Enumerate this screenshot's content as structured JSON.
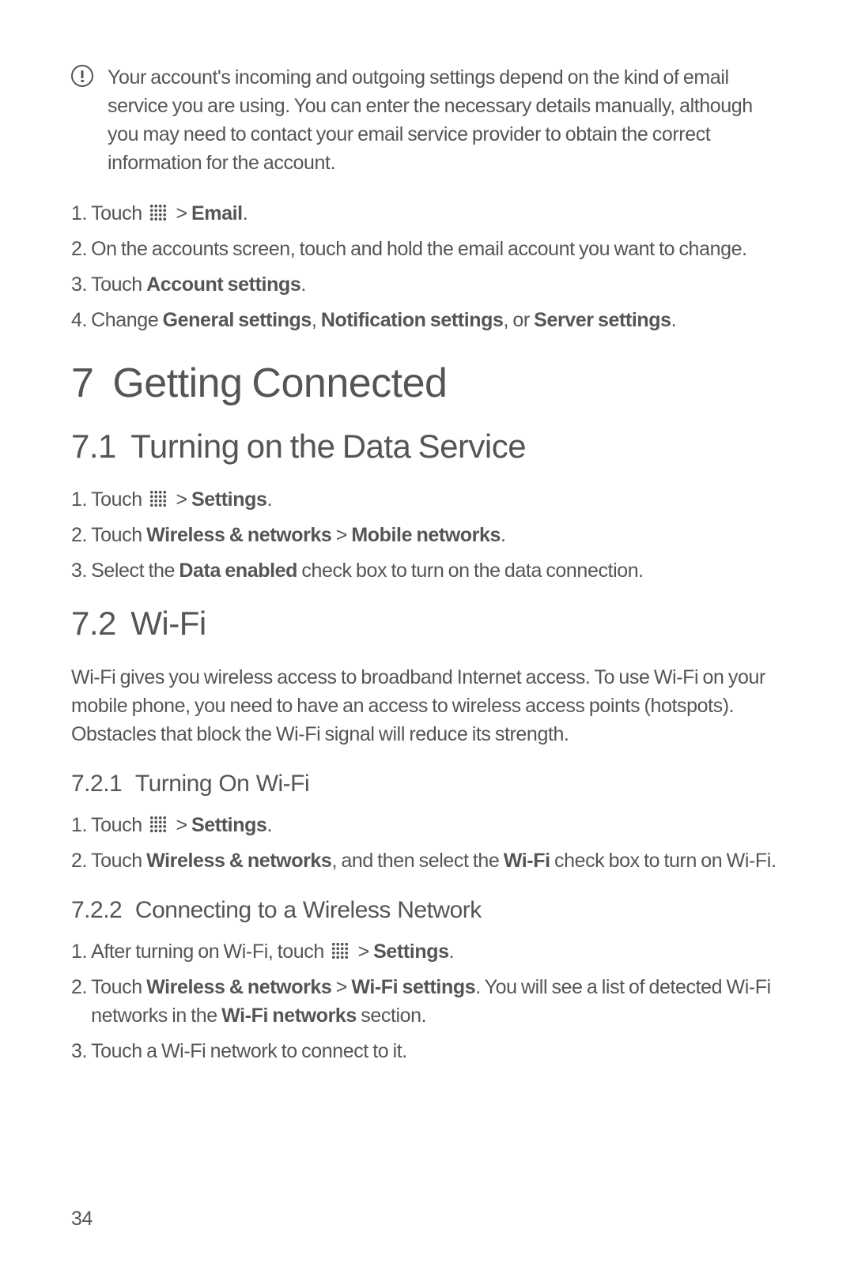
{
  "note": {
    "text": "Your account's incoming and outgoing settings depend on the kind of email service you are using. You can enter the necessary details manually, although you may need to contact your email service provider to obtain the correct information for the account."
  },
  "listA": {
    "i1": {
      "n": "1.",
      "pre": "Touch ",
      "post": " > ",
      "bold": "Email",
      "tail": "."
    },
    "i2": {
      "n": "2.",
      "text": "On the accounts screen, touch and hold the email account you want to change."
    },
    "i3": {
      "n": "3.",
      "pre": "Touch ",
      "bold": "Account settings",
      "tail": "."
    },
    "i4": {
      "n": "4.",
      "pre": "Change ",
      "b1": "General settings",
      "sep1": ", ",
      "b2": "Notification settings",
      "sep2": ", or ",
      "b3": "Server settings",
      "tail": "."
    }
  },
  "h1": {
    "num": "7",
    "title": "Getting Connected"
  },
  "h2a": {
    "num": "7.1",
    "title": "Turning on the Data Service"
  },
  "listB": {
    "i1": {
      "n": "1.",
      "pre": "Touch ",
      "post": " > ",
      "bold": "Settings",
      "tail": "."
    },
    "i2": {
      "n": "2.",
      "pre": "Touch ",
      "b1": "Wireless & networks",
      "sep": " > ",
      "b2": "Mobile networks",
      "tail": "."
    },
    "i3": {
      "n": "3.",
      "pre": "Select the ",
      "bold": "Data enabled",
      "tail": " check box to turn on the data connection."
    }
  },
  "h2b": {
    "num": "7.2",
    "title": "Wi-Fi"
  },
  "wifiPara": "Wi-Fi gives you wireless access to broadband Internet access. To use Wi-Fi on your mobile phone, you need to have an access to wireless access points (hotspots). Obstacles that block the Wi-Fi signal will reduce its strength.",
  "h3a": {
    "num": "7.2.1",
    "title": "Turning On Wi-Fi"
  },
  "listC": {
    "i1": {
      "n": "1.",
      "pre": "Touch ",
      "post": " > ",
      "bold": "Settings",
      "tail": "."
    },
    "i2": {
      "n": "2.",
      "pre": "Touch ",
      "b1": "Wireless & networks",
      "mid": ", and then select the ",
      "b2": "Wi-Fi",
      "tail": " check box to turn on Wi-Fi."
    }
  },
  "h3b": {
    "num": "7.2.2",
    "title": "Connecting to a Wireless Network"
  },
  "listD": {
    "i1": {
      "n": "1.",
      "pre": "After turning on Wi-Fi, touch ",
      "post": " > ",
      "bold": "Settings",
      "tail": "."
    },
    "i2": {
      "n": "2.",
      "pre": "Touch ",
      "b1": "Wireless & networks",
      "sep": " > ",
      "b2": "Wi-Fi settings",
      "mid": ". You will see a list of detected Wi-Fi networks in the ",
      "b3": "Wi-Fi networks",
      "tail": " section."
    },
    "i3": {
      "n": "3.",
      "text": "Touch a Wi-Fi network to connect to it."
    }
  },
  "pageNumber": "34"
}
